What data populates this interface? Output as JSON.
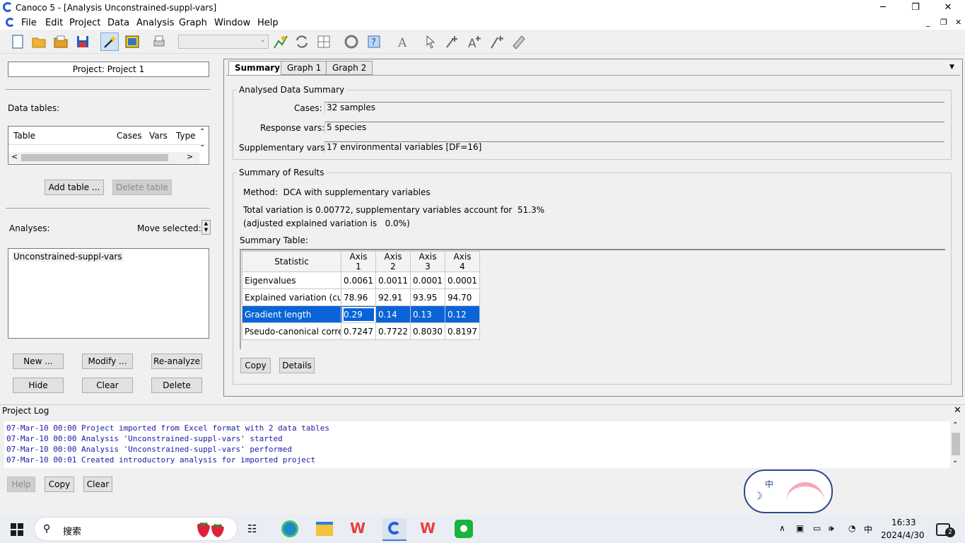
{
  "window": {
    "title": "Canoco 5 - [Analysis Unconstrained-suppl-vars]"
  },
  "menu": [
    "File",
    "Edit",
    "Project",
    "Data",
    "Analysis",
    "Graph",
    "Window",
    "Help"
  ],
  "left": {
    "project_label": "Project: Project 1",
    "data_tables_label": "Data tables:",
    "table_headers": [
      "Table",
      "Cases",
      "Vars",
      "Type"
    ],
    "add_table": "Add table ...",
    "delete_table": "Delete table",
    "analyses_label": "Analyses:",
    "move_selected": "Move selected:",
    "analysis_item": "Unconstrained-suppl-vars",
    "buttons": [
      "New ...",
      "Modify ...",
      "Re-analyze",
      "Hide",
      "Clear",
      "Delete"
    ]
  },
  "tabs": [
    "Summary",
    "Graph 1",
    "Graph 2"
  ],
  "summary": {
    "analysed_title": "Analysed Data Summary",
    "cases_label": "Cases:",
    "cases_value": "32 samples",
    "response_label": "Response vars:",
    "response_value": "5 species",
    "supp_label": "Supplementary vars:",
    "supp_value": "17 environmental variables [DF=16]",
    "results_title": "Summary of Results",
    "method": "Method:  DCA with supplementary variables",
    "total_variation": "Total variation is 0.00772, supplementary variables account for  51.3%",
    "adjusted": "(adjusted explained variation is   0.0%)",
    "table_label": "Summary Table:",
    "headers": [
      "Statistic",
      "Axis 1",
      "Axis 2",
      "Axis 3",
      "Axis 4"
    ],
    "rows": [
      [
        "Eigenvalues",
        "0.0061",
        "0.0011",
        "0.0001",
        "0.0001"
      ],
      [
        "Explained variation (cumu",
        "78.96",
        "92.91",
        "93.95",
        "94.70"
      ],
      [
        "Gradient length",
        "0.29",
        "0.14",
        "0.13",
        "0.12"
      ],
      [
        "Pseudo-canonical correlat",
        "0.7247",
        "0.7722",
        "0.8030",
        "0.8197"
      ]
    ],
    "copy": "Copy",
    "details": "Details"
  },
  "log": {
    "title": "Project Log",
    "lines": [
      "07-Mar-10 00:00 Project imported from Excel format with 2 data tables",
      "07-Mar-10 00:00 Analysis 'Unconstrained-suppl-vars' started",
      "07-Mar-10 00:00 Analysis 'Unconstrained-suppl-vars' performed",
      "07-Mar-10 00:01 Created introductory analysis for imported project"
    ],
    "help": "Help",
    "copy": "Copy",
    "clear": "Clear"
  },
  "taskbar": {
    "search": "搜索",
    "time": "16:33",
    "date": "2024/4/30",
    "ime": "中",
    "notifications": "2"
  }
}
